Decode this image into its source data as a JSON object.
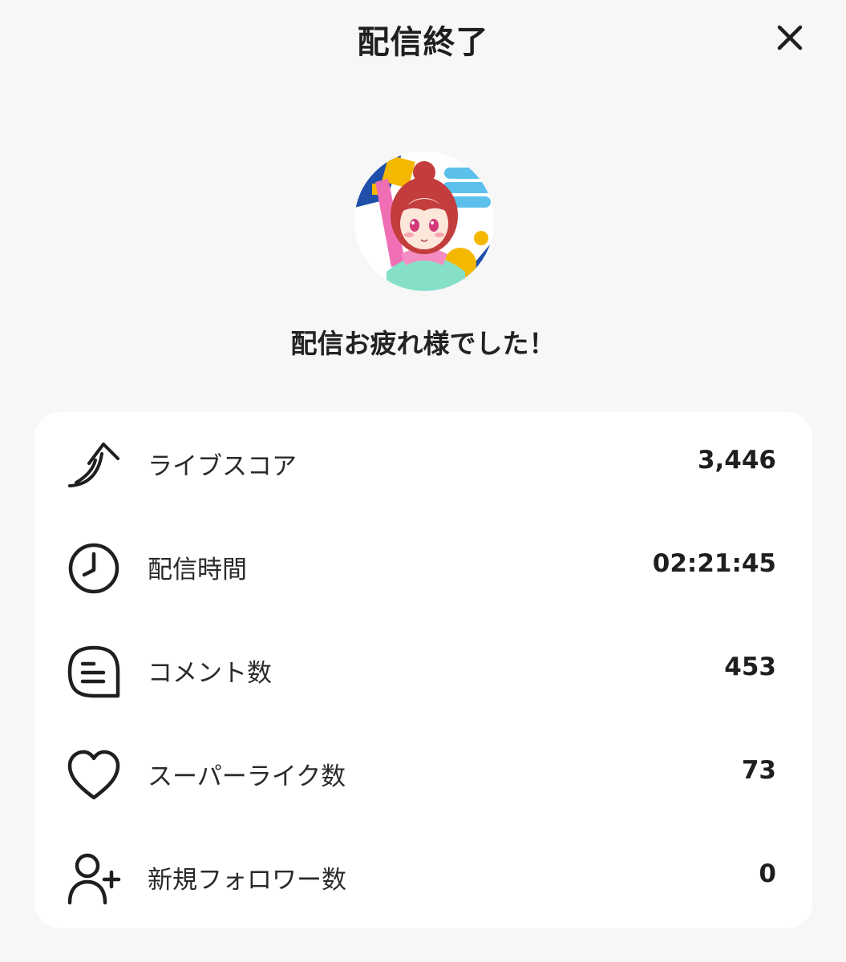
{
  "header": {
    "title": "配信終了",
    "close_icon": "close-icon"
  },
  "profile": {
    "avatar_icon": "streamer-avatar",
    "message": "配信お疲れ様でした！"
  },
  "stats": [
    {
      "icon": "trend-up-arrow-icon",
      "label": "ライブスコア",
      "value": "3,446"
    },
    {
      "icon": "clock-icon",
      "label": "配信時間",
      "value": "02:21:45"
    },
    {
      "icon": "comment-icon",
      "label": "コメント数",
      "value": "453"
    },
    {
      "icon": "heart-icon",
      "label": "スーパーライク数",
      "value": "73"
    },
    {
      "icon": "user-plus-icon",
      "label": "新規フォロワー数",
      "value": "0"
    }
  ],
  "colors": {
    "background": "#f7f7f7",
    "card": "#ffffff",
    "text": "#222222",
    "avatar_accent_blue": "#1f4fa8",
    "avatar_accent_yellow": "#f5b800",
    "avatar_hair": "#c43d3d"
  }
}
